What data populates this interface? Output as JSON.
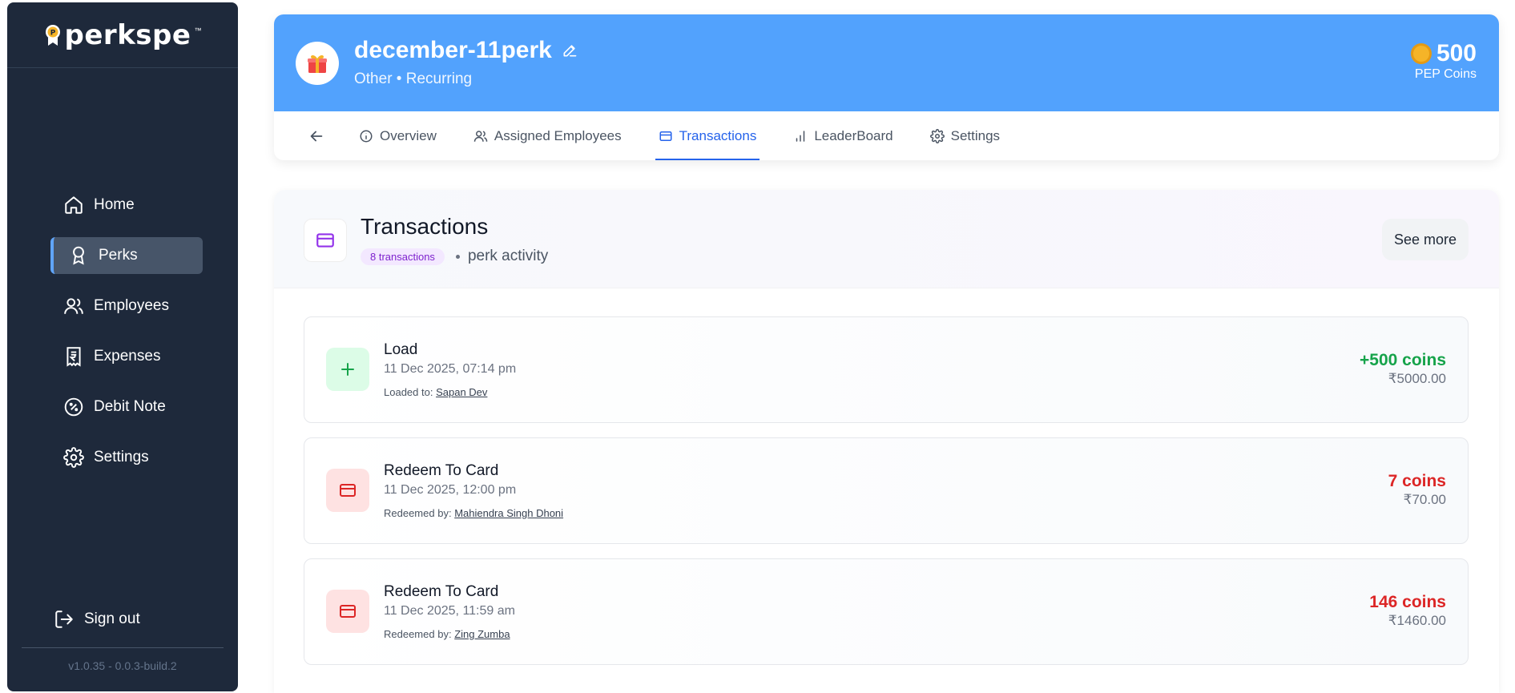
{
  "brand": {
    "name": "perkspe",
    "tm": "™"
  },
  "sidebar": {
    "items": [
      {
        "label": "Home",
        "icon": "home-icon"
      },
      {
        "label": "Perks",
        "icon": "award-icon",
        "active": true
      },
      {
        "label": "Employees",
        "icon": "users-icon"
      },
      {
        "label": "Expenses",
        "icon": "receipt-rupee-icon"
      },
      {
        "label": "Debit Note",
        "icon": "badge-percent-icon"
      },
      {
        "label": "Settings",
        "icon": "gear-icon"
      }
    ],
    "signout_label": "Sign out",
    "version": "v1.0.35 - 0.0.3-build.2"
  },
  "perk": {
    "title": "december-11perk",
    "subtitle": "Other • Recurring",
    "coins_value": "500",
    "coins_label": "PEP Coins"
  },
  "tabs": [
    {
      "label": "Overview",
      "icon": "info-icon"
    },
    {
      "label": "Assigned Employees",
      "icon": "users-icon"
    },
    {
      "label": "Transactions",
      "icon": "card-icon",
      "active": true
    },
    {
      "label": "LeaderBoard",
      "icon": "bar-chart-icon"
    },
    {
      "label": "Settings",
      "icon": "gear-icon"
    }
  ],
  "transactions": {
    "title": "Transactions",
    "count_badge": "8 transactions",
    "subtitle": "perk activity",
    "see_more_label": "See more",
    "items": [
      {
        "type": "Load",
        "date": "11 Dec 2025, 07:14 pm",
        "who_prefix": "Loaded to:",
        "who_name": "Sapan Dev",
        "coins": "+500 coins",
        "inr": "₹5000.00",
        "kind": "load"
      },
      {
        "type": "Redeem To Card",
        "date": "11 Dec 2025, 12:00 pm",
        "who_prefix": "Redeemed by:",
        "who_name": "Mahiendra Singh Dhoni",
        "coins": "7 coins",
        "inr": "₹70.00",
        "kind": "redeem"
      },
      {
        "type": "Redeem To Card",
        "date": "11 Dec 2025, 11:59 am",
        "who_prefix": "Redeemed by:",
        "who_name": "Zing Zumba",
        "coins": "146 coins",
        "inr": "₹1460.00",
        "kind": "redeem"
      }
    ]
  },
  "colors": {
    "sidebar_bg": "#1e293b",
    "header_blue": "#52a2fd",
    "accent": "#2563eb",
    "positive": "#16a34a",
    "negative": "#dc2626",
    "badge_purple": "#7e22ce"
  }
}
